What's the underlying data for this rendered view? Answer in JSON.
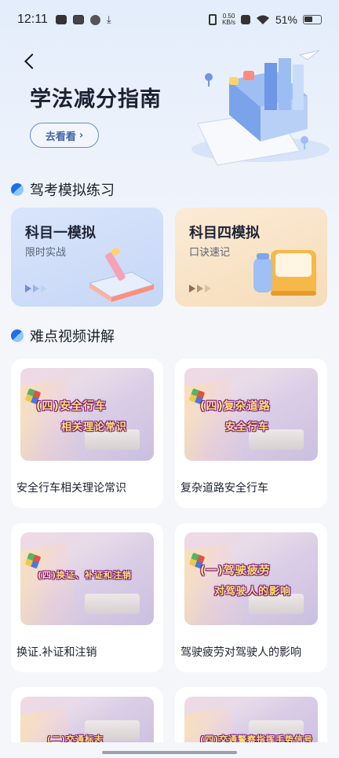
{
  "status_bar": {
    "time": "12:11",
    "net_speed_value": "0.50",
    "net_speed_unit": "KB/s",
    "battery": "51%"
  },
  "hero": {
    "title": "学法减分指南",
    "button_label": "去看看",
    "button_arrow": "›"
  },
  "sections": {
    "practice_title": "驾考模拟练习",
    "video_title": "难点视频讲解"
  },
  "practice_cards": [
    {
      "title": "科目一模拟",
      "subtitle": "限时实战",
      "theme": "blue"
    },
    {
      "title": "科目四模拟",
      "subtitle": "口诀速记",
      "theme": "orange"
    }
  ],
  "videos": [
    {
      "thumb_line1": "(四)安全行车",
      "thumb_line2": "相关理论常识",
      "caption": "安全行车相关理论常识"
    },
    {
      "thumb_line1": "(四)复杂道路",
      "thumb_line2": "安全行车",
      "caption": "复杂道路安全行车"
    },
    {
      "thumb_line1": "(四)换证、补证和注销",
      "thumb_line2": "",
      "caption": "换证.补证和注销"
    },
    {
      "thumb_line1": "(一)驾驶疲劳",
      "thumb_line2": "对驾驶人的影响",
      "caption": "驾驶疲劳对驾驶人的影响"
    },
    {
      "thumb_line1": "(二)交通标志",
      "thumb_line2": "",
      "caption": ""
    },
    {
      "thumb_line1": "(四)交通警察指挥手势信号",
      "thumb_line2": "",
      "caption": ""
    }
  ],
  "colors": {
    "accent_blue": "#1e6fe8",
    "button_border": "#6a8bc7",
    "card_blue": "#d9e5fb",
    "card_orange": "#fbebd6"
  }
}
